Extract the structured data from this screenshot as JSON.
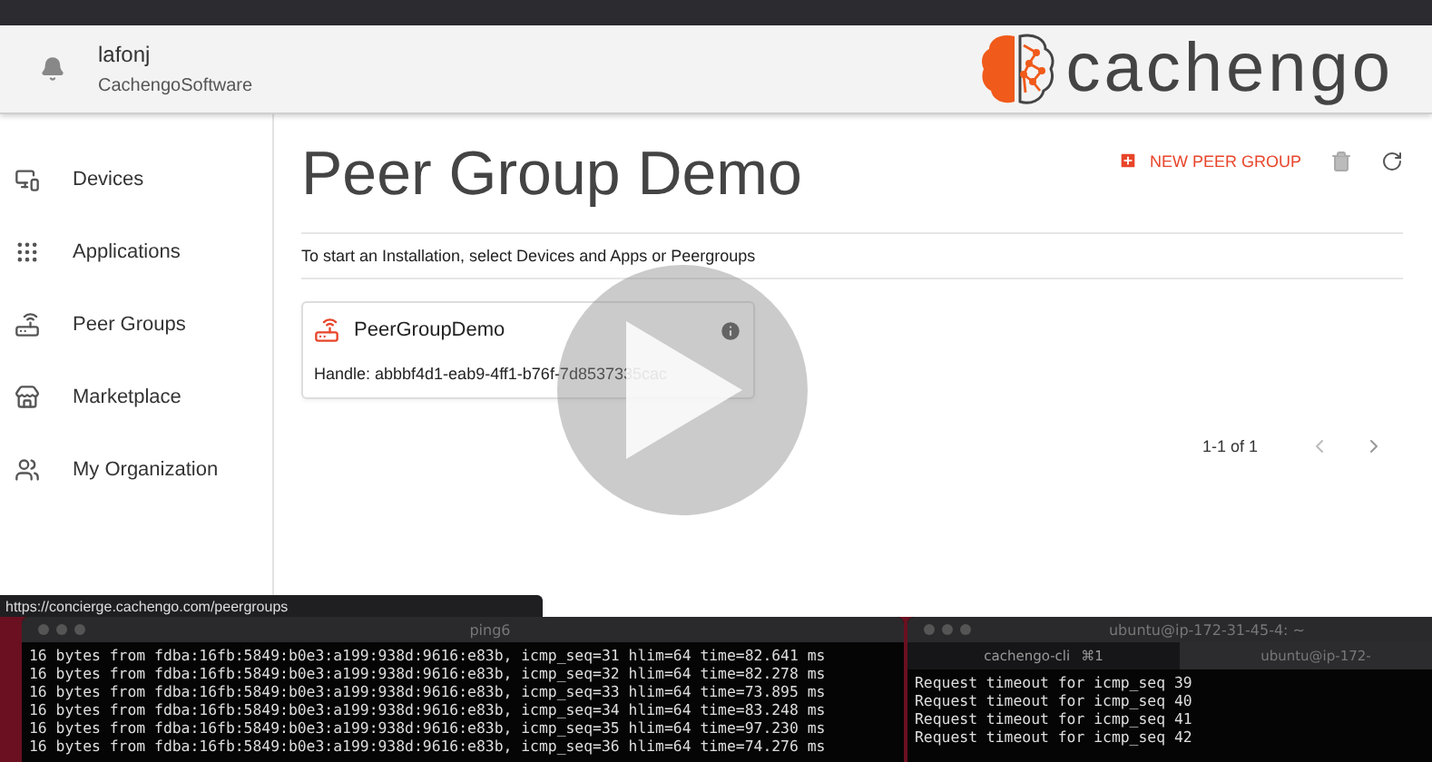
{
  "header": {
    "user": "lafonj",
    "organization": "CachengoSoftware",
    "logo_text": "cachengo"
  },
  "sidebar": {
    "items": [
      {
        "label": "Devices"
      },
      {
        "label": "Applications"
      },
      {
        "label": "Peer Groups"
      },
      {
        "label": "Marketplace"
      },
      {
        "label": "My Organization"
      }
    ]
  },
  "page": {
    "title": "Peer Group Demo",
    "new_button": "NEW PEER GROUP",
    "instruction": "To start an Installation, select Devices and Apps or Peergroups",
    "cards": [
      {
        "name": "PeerGroupDemo",
        "handle": "Handle: abbbf4d1-eab9-4ff1-b76f-7d8537335cac"
      }
    ],
    "pagination": "1-1 of 1"
  },
  "status_url": "https://concierge.cachengo.com/peergroups",
  "terminals": [
    {
      "title": "ping6",
      "lines": [
        "16 bytes from fdba:16fb:5849:b0e3:a199:938d:9616:e83b, icmp_seq=31 hlim=64 time=82.641 ms",
        "16 bytes from fdba:16fb:5849:b0e3:a199:938d:9616:e83b, icmp_seq=32 hlim=64 time=82.278 ms",
        "16 bytes from fdba:16fb:5849:b0e3:a199:938d:9616:e83b, icmp_seq=33 hlim=64 time=73.895 ms",
        "16 bytes from fdba:16fb:5849:b0e3:a199:938d:9616:e83b, icmp_seq=34 hlim=64 time=83.248 ms",
        "16 bytes from fdba:16fb:5849:b0e3:a199:938d:9616:e83b, icmp_seq=35 hlim=64 time=97.230 ms",
        "16 bytes from fdba:16fb:5849:b0e3:a199:938d:9616:e83b, icmp_seq=36 hlim=64 time=74.276 ms"
      ]
    },
    {
      "title": "ubuntu@ip-172-31-45-4: ~",
      "tabs": [
        {
          "label": "cachengo-cli",
          "shortcut": "⌘1",
          "selected": true
        },
        {
          "label": "ubuntu@ip-172-",
          "selected": false
        }
      ],
      "lines": [
        "Request timeout for icmp_seq 39",
        "Request timeout for icmp_seq 40",
        "Request timeout for icmp_seq 41",
        "Request timeout for icmp_seq 42"
      ]
    }
  ]
}
